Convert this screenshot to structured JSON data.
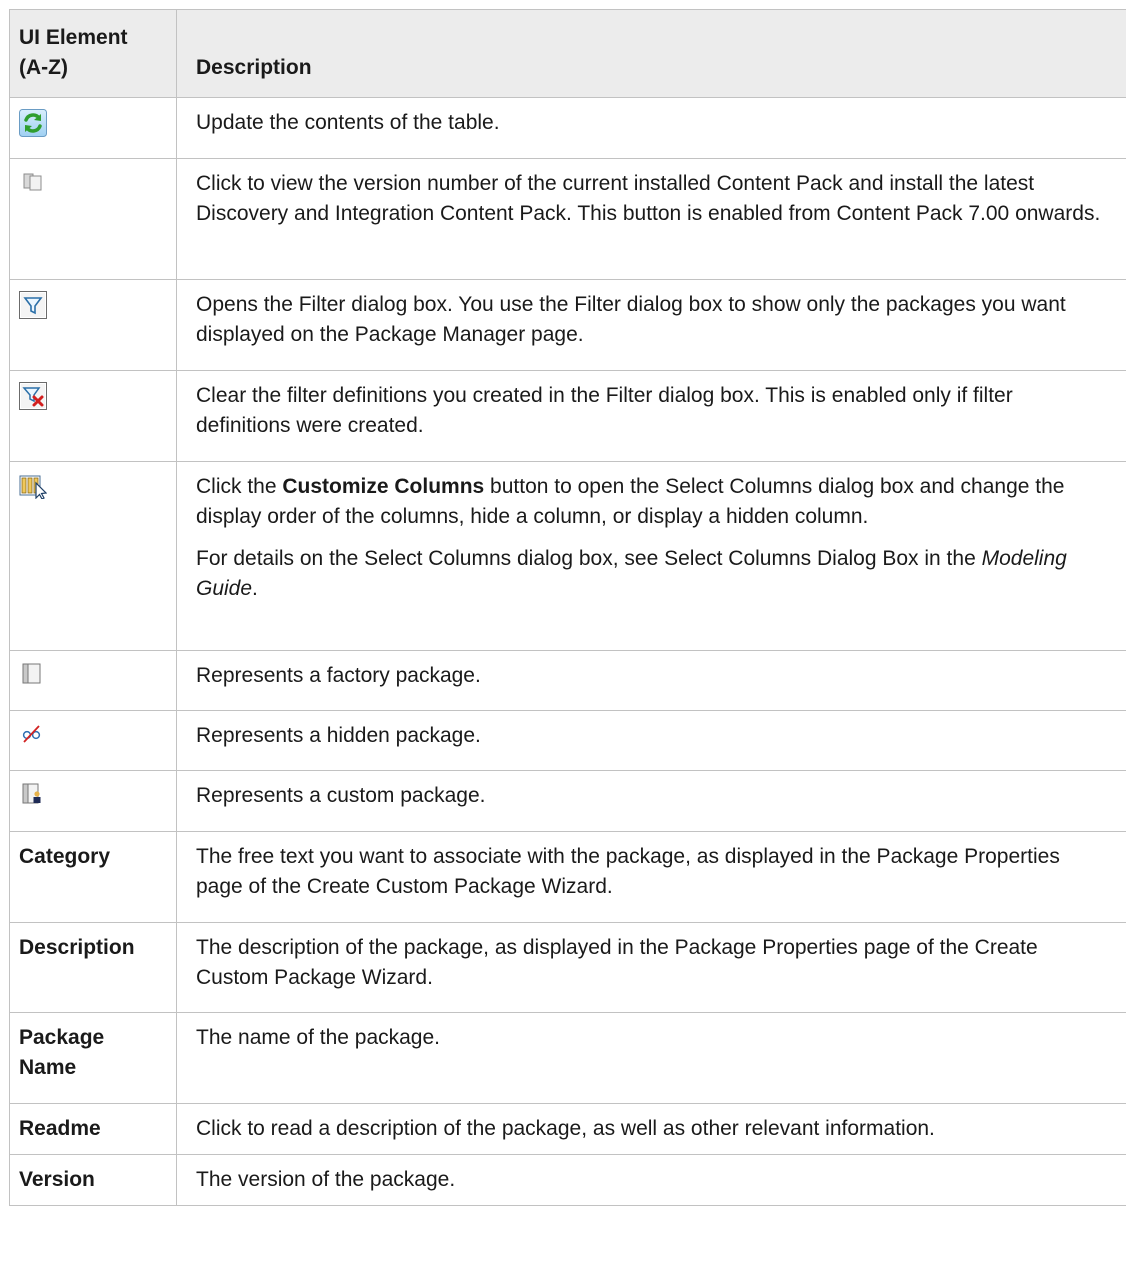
{
  "table": {
    "header": {
      "col1": "UI Element\n(A-Z)",
      "col2": "Description"
    },
    "icon_rows": [
      {
        "icon": "refresh-icon",
        "desc": "Update the contents of the table."
      },
      {
        "icon": "content-pack-icon",
        "desc": "Click to view the version number of the current installed Content Pack and install the latest Discovery and Integration Content Pack. This button is enabled from Content Pack 7.00 onwards."
      },
      {
        "icon": "filter-icon",
        "desc": "Opens the Filter dialog box. You use the Filter dialog box to show only the packages you want displayed on the Package Manager page."
      },
      {
        "icon": "clear-filter-icon",
        "desc": "Clear the filter definitions you created in the Filter dialog box. This is enabled only if filter definitions were created."
      },
      {
        "icon": "customize-columns-icon",
        "desc_parts": {
          "pre": "Click the ",
          "bold": "Customize Columns",
          "post": " button to open the Select Columns dialog box and change the display order of the columns, hide a column, or display a hidden column."
        },
        "desc2_parts": {
          "pre": "For details on the Select Columns dialog box, see Select Columns Dialog Box in the ",
          "italic": "Modeling Guide",
          "post": "."
        }
      },
      {
        "icon": "factory-package-icon",
        "desc": "Represents a factory package."
      },
      {
        "icon": "hidden-package-icon",
        "desc": "Represents a hidden package."
      },
      {
        "icon": "custom-package-icon",
        "desc": "Represents a custom package."
      }
    ],
    "text_rows": [
      {
        "name": "Category",
        "desc": "The free text you want to associate with the package, as displayed in the Package Properties page of the Create Custom Package Wizard."
      },
      {
        "name": "Description",
        "desc": "The description of the package, as displayed in the Package Properties page of the Create Custom Package Wizard."
      },
      {
        "name": "Package\nName",
        "desc": "The name of the package."
      },
      {
        "name": "Readme",
        "desc": "Click to read a description of the package, as well as other relevant information."
      },
      {
        "name": "Version",
        "desc": "The version of the package."
      }
    ]
  }
}
